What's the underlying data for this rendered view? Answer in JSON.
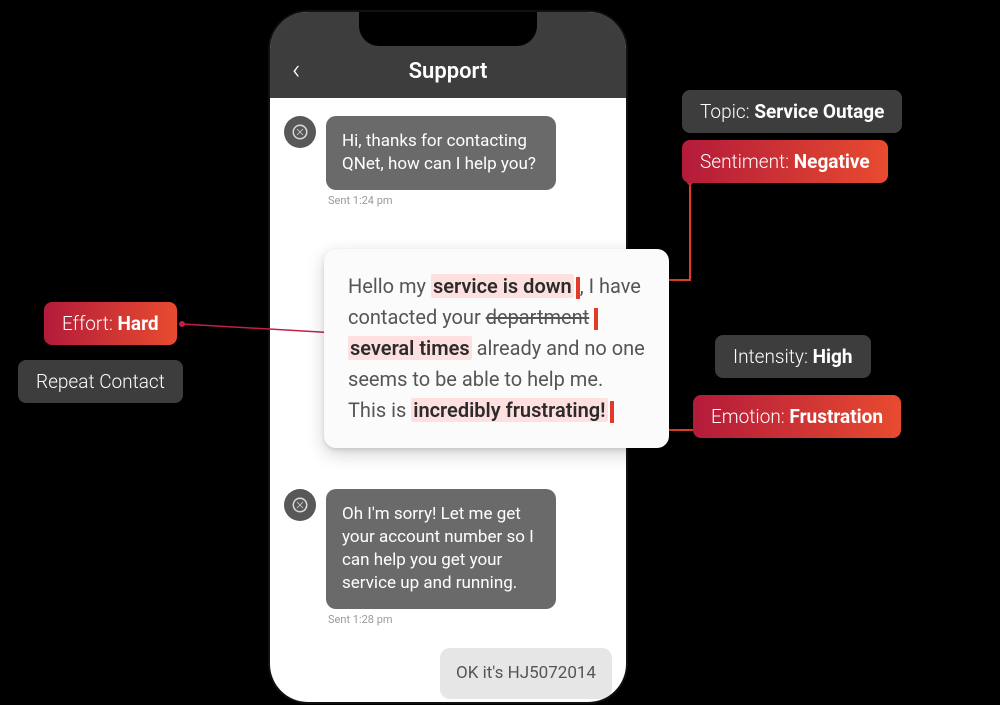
{
  "header": {
    "title": "Support"
  },
  "messages": {
    "agent1": {
      "text": "Hi, thanks for contacting QNet, how can I help you?",
      "timestamp": "Sent 1:24 pm"
    },
    "user1": {
      "pre1": "Hello my ",
      "hl1": "service is down",
      "post1": ", I have contacted your ",
      "strike": "department",
      "hl2": "several times",
      "post2": " already and no one seems to be able to help me. This is ",
      "hl3": "incredibly frustrating!"
    },
    "agent2": {
      "text": "Oh I'm sorry! Let me get your account number so I can help you get your service up and running.",
      "timestamp": "Sent 1:28 pm"
    },
    "user2": {
      "text": "OK it's HJ5072014"
    }
  },
  "annotations": {
    "topic": {
      "label": "Topic: ",
      "value": "Service Outage"
    },
    "sentiment": {
      "label": "Sentiment: ",
      "value": "Negative"
    },
    "intensity": {
      "label": "Intensity: ",
      "value": "High"
    },
    "emotion": {
      "label": "Emotion: ",
      "value": "Frustration"
    },
    "effort": {
      "label": "Effort: ",
      "value": "Hard"
    },
    "repeat": {
      "label": "Repeat Contact"
    }
  }
}
